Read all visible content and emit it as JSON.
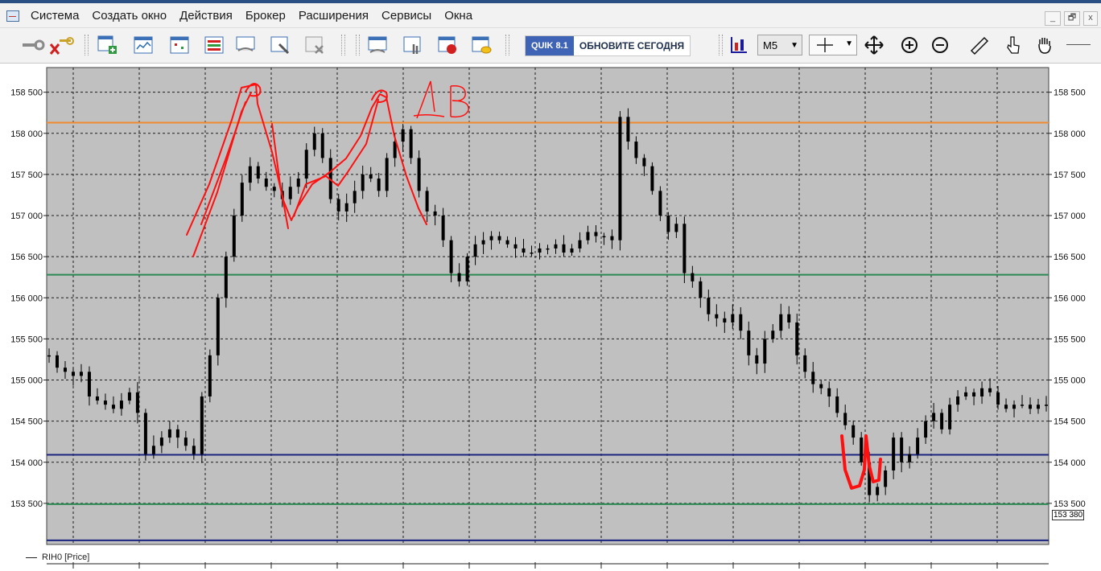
{
  "menu": {
    "items": [
      "Система",
      "Создать окно",
      "Действия",
      "Брокер",
      "Расширения",
      "Сервисы",
      "Окна"
    ]
  },
  "window_controls": [
    "_",
    "🗗",
    "x"
  ],
  "toolbar": {
    "banner_version": "QUIK 8.1",
    "banner_text": "ОБНОВИТЕ СЕГОДНЯ",
    "timeframe": "M5",
    "icons": [
      "key-icon",
      "disconnect-icon",
      "add-table-icon",
      "chart-window-icon",
      "quotes-icon",
      "orders-table-icon",
      "deals-icon",
      "settings-icon",
      "delete-table-icon",
      "trade-icon",
      "order-hand-icon",
      "stop-order-icon",
      "portfolio-icon",
      "chart-type-icon",
      "crosshair-icon",
      "move-icon",
      "zoom-in-icon",
      "zoom-out-icon",
      "ruler-icon",
      "pointer-hand-icon",
      "grab-hand-icon"
    ]
  },
  "chart_data": {
    "type": "line",
    "series": [
      {
        "name": "RIH0 [Price]",
        "values": [
          155300,
          155150,
          155100,
          155050,
          155100,
          154800,
          154750,
          154700,
          154650,
          154750,
          154850,
          154600,
          154100,
          154200,
          154300,
          154400,
          154300,
          154200,
          154100,
          154800,
          155300,
          156000,
          156500,
          157000,
          157400,
          157600,
          157450,
          157350,
          157300,
          157200,
          157350,
          157450,
          157800,
          158000,
          157700,
          157200,
          157050,
          157150,
          157300,
          157500,
          157450,
          157300,
          157700,
          157900,
          158050,
          157700,
          157300,
          157050,
          157000,
          156700,
          156300,
          156200,
          156500,
          156650,
          156700,
          156750,
          156700,
          156650,
          156600,
          156550,
          156550,
          156600,
          156600,
          156650,
          156550,
          156600,
          156700,
          156800,
          156750,
          156750,
          156700,
          158200,
          157900,
          157700,
          157600,
          157300,
          157000,
          156800,
          156900,
          156300,
          156200,
          156000,
          155800,
          155750,
          155700,
          155800,
          155600,
          155300,
          155200,
          155500,
          155600,
          155800,
          155700,
          155300,
          155100,
          154950,
          154900,
          154800,
          154600,
          154450,
          154300,
          154000,
          153600,
          153700,
          153900,
          154300,
          154000,
          154100,
          154300,
          154500,
          154600,
          154400,
          154700,
          154800,
          154850,
          154800,
          154900,
          154850,
          154700,
          154650,
          154700,
          154700,
          154650,
          154700,
          154700
        ]
      }
    ],
    "ylim": [
      153000,
      158800
    ],
    "yticks": [
      158500,
      158000,
      157500,
      157000,
      156500,
      156000,
      155500,
      155000,
      154500,
      154000,
      153500
    ],
    "ytick_labels": [
      "158 500",
      "158 000",
      "157 500",
      "157 000",
      "156 500",
      "156 000",
      "155 500",
      "155 000",
      "154 500",
      "154 000",
      "153 500"
    ],
    "last_price_label": "153 380",
    "hlines": [
      {
        "value": 158130,
        "color": "#f08a30"
      },
      {
        "value": 156280,
        "color": "#2a8a52"
      },
      {
        "value": 154090,
        "color": "#1a237e"
      },
      {
        "value": 153490,
        "color": "#2a8a52"
      },
      {
        "value": 153050,
        "color": "#1a237e"
      }
    ],
    "grid": true,
    "plot_background": "#c0c0c0",
    "annotation_color": "#ff1010",
    "legend": "bottom-left"
  }
}
